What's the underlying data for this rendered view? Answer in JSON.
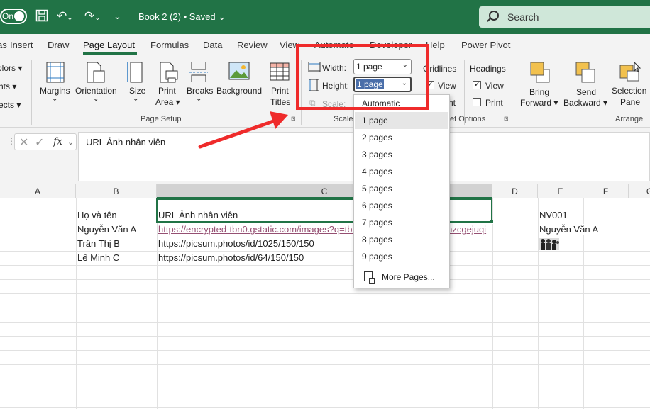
{
  "titlebar": {
    "autosave_label": "On",
    "document_title": "Book 2 (2) • Saved",
    "search_placeholder": "Search"
  },
  "tabs": [
    {
      "label": "ulas"
    },
    {
      "label": "Insert"
    },
    {
      "label": "Draw"
    },
    {
      "label": "Page Layout"
    },
    {
      "label": "Formulas"
    },
    {
      "label": "Data"
    },
    {
      "label": "Review"
    },
    {
      "label": "View"
    },
    {
      "label": "Automate"
    },
    {
      "label": "Developer"
    },
    {
      "label": "Help"
    },
    {
      "label": "Power Pivot"
    }
  ],
  "ribbon": {
    "left_cut": [
      "olors ▾",
      "nts ▾",
      "ects ▾"
    ],
    "page_setup": {
      "margins": "Margins",
      "orientation": "Orientation",
      "size": "Size",
      "print_area_1": "Print",
      "print_area_2": "Area ▾",
      "breaks": "Breaks",
      "background": "Background",
      "print_titles_1": "Print",
      "print_titles_2": "Titles",
      "group_label": "Page Setup"
    },
    "scale_to_fit": {
      "width_label": "Width:",
      "width_value": "1 page",
      "height_label": "Height:",
      "height_value": "1 page",
      "scale_label": "Scale:",
      "group_label": "Scale"
    },
    "sheet_options": {
      "gridlines": "Gridlines",
      "headings": "Headings",
      "view": "View",
      "print": "Print",
      "print_cut": "nt",
      "group_label": "et Options"
    },
    "arrange": {
      "bring_forward_1": "Bring",
      "bring_forward_2": "Forward ▾",
      "send_backward_1": "Send",
      "send_backward_2": "Backward ▾",
      "selection_pane_1": "Selection",
      "selection_pane_2": "Pane",
      "group_label": "Arrange"
    }
  },
  "formula_bar": {
    "fx_label": "fx",
    "content": "URL Ảnh nhân viên"
  },
  "columns": [
    "A",
    "B",
    "C",
    "D",
    "E",
    "F",
    "G"
  ],
  "cells": {
    "b1": "Họ và tên",
    "c1": "URL Ảnh nhân viên",
    "e1": "NV001",
    "b2": "Nguyễn Văn A",
    "c2": "https://encrypted-tbn0.gstatic.com/images?q=tbn:ANd9GcTxYNGwItsTnzcgejuqi",
    "e2": "Nguyễn Văn A",
    "b3": "Trần Thị B",
    "c3": "https://picsum.photos/id/1025/150/150",
    "b4": "Lê Minh C",
    "c4": "https://picsum.photos/id/64/150/150"
  },
  "height_menu": {
    "items": [
      "Automatic",
      "1 page",
      "2 pages",
      "3 pages",
      "4 pages",
      "5 pages",
      "6 pages",
      "7 pages",
      "8 pages",
      "9 pages"
    ],
    "more": "More Pages...",
    "highlighted_index": 1
  },
  "colors": {
    "brand_green": "#217346",
    "annotation_red": "#ef2b2b",
    "link_color": "#954f72"
  }
}
